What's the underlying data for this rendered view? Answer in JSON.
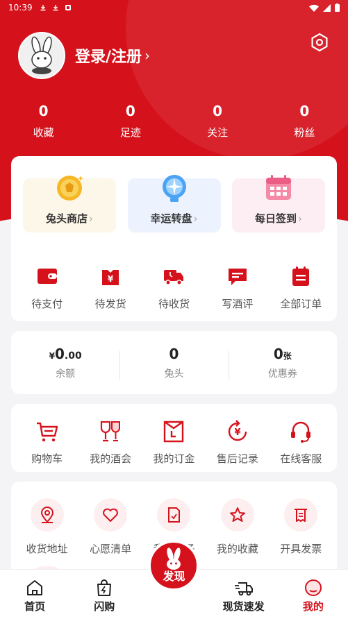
{
  "status_bar": {
    "time": "10:39"
  },
  "profile": {
    "login_label": "登录/注册",
    "login_arrow": "›"
  },
  "stats": [
    {
      "value": "0",
      "label": "收藏"
    },
    {
      "value": "0",
      "label": "足迹"
    },
    {
      "value": "0",
      "label": "关注"
    },
    {
      "value": "0",
      "label": "粉丝"
    }
  ],
  "promos": [
    {
      "label": "兔头商店",
      "icon": "coin-bag-icon"
    },
    {
      "label": "幸运转盘",
      "icon": "wheel-icon"
    },
    {
      "label": "每日签到",
      "icon": "calendar-icon"
    }
  ],
  "promo_chevron": "›",
  "orders": [
    {
      "label": "待支付",
      "icon": "wallet-icon"
    },
    {
      "label": "待发货",
      "icon": "yen-box-icon"
    },
    {
      "label": "待收货",
      "icon": "truck-icon"
    },
    {
      "label": "写酒评",
      "icon": "comment-icon"
    },
    {
      "label": "全部订单",
      "icon": "order-list-icon"
    }
  ],
  "wallet": {
    "balance_prefix": "¥",
    "balance_int": "0",
    "balance_dec": ".00",
    "balance_label": "余额",
    "tutou_value": "0",
    "tutou_label": "兔头",
    "coupon_value": "0",
    "coupon_unit": "张",
    "coupon_label": "优惠券"
  },
  "tools": [
    {
      "label": "购物车",
      "icon": "cart-icon"
    },
    {
      "label": "我的酒会",
      "icon": "wine-glass-icon"
    },
    {
      "label": "我的订金",
      "icon": "deposit-icon"
    },
    {
      "label": "售后记录",
      "icon": "refund-icon"
    },
    {
      "label": "在线客服",
      "icon": "headset-icon"
    }
  ],
  "services": [
    {
      "label": "收货地址",
      "icon": "location-icon"
    },
    {
      "label": "心愿清单",
      "icon": "heart-icon"
    },
    {
      "label": "我的帖子",
      "icon": "post-icon"
    },
    {
      "label": "我的收藏",
      "icon": "star-icon"
    },
    {
      "label": "开具发票",
      "icon": "invoice-icon"
    }
  ],
  "tabbar": [
    {
      "label": "首页",
      "icon": "home-icon"
    },
    {
      "label": "闪购",
      "icon": "flash-bag-icon"
    },
    {
      "label": "发现",
      "icon": "rabbit-icon"
    },
    {
      "label": "现货速发",
      "icon": "fast-truck-icon"
    },
    {
      "label": "我的",
      "icon": "profile-icon"
    }
  ],
  "colors": {
    "brand": "#d5121c",
    "background": "#f4f4f6"
  }
}
